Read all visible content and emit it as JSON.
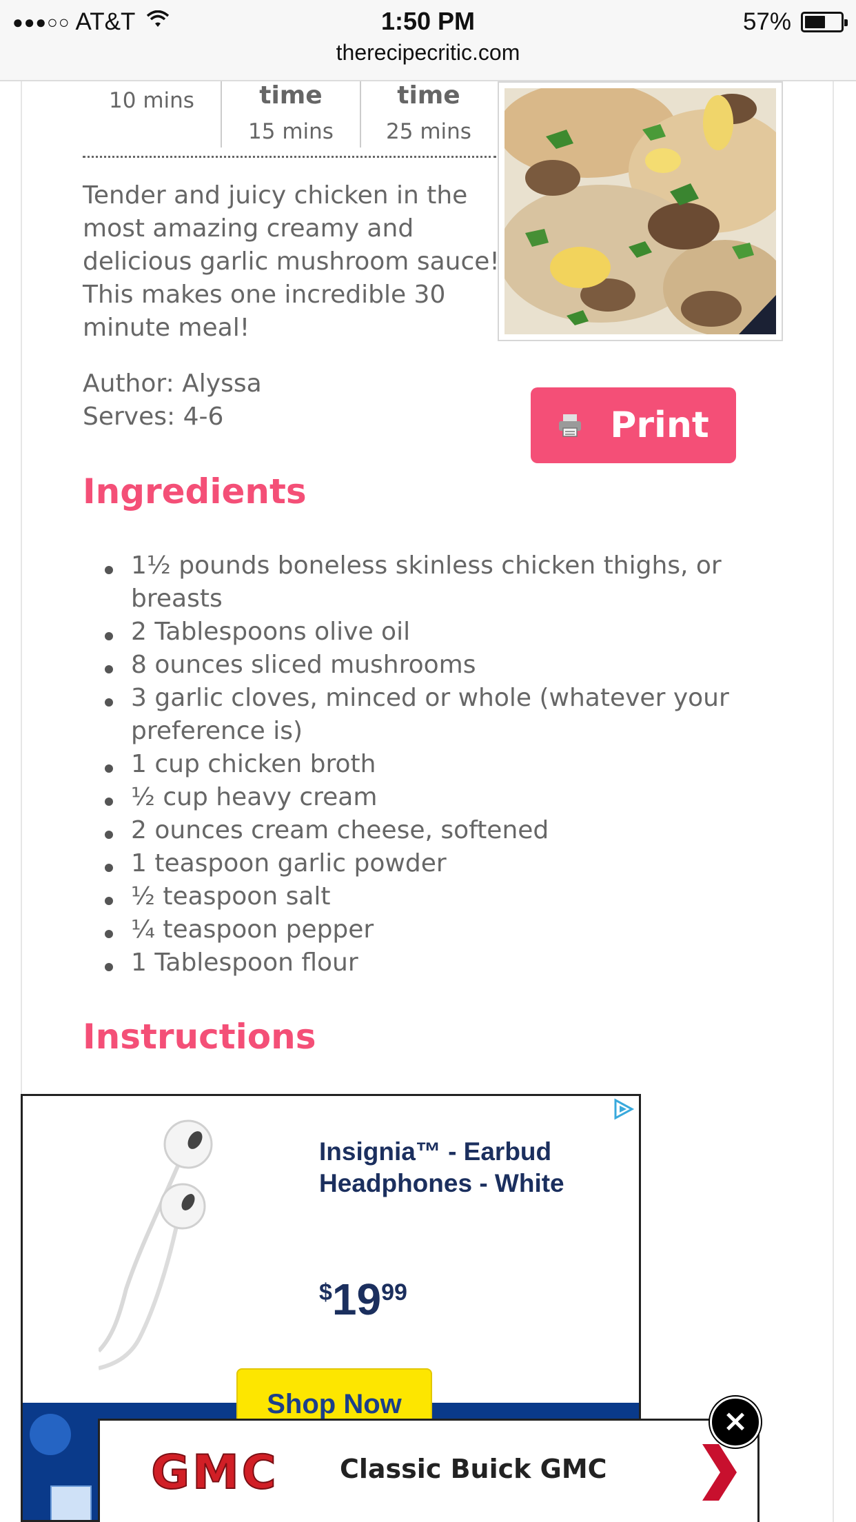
{
  "status_bar": {
    "signal": "●●●○○",
    "carrier": "AT&T",
    "time": "1:50 PM",
    "battery_percent": "57%",
    "battery_level": 0.57
  },
  "browser": {
    "url": "therecipecritic.com"
  },
  "recipe": {
    "times": [
      {
        "label": "",
        "value": "10 mins"
      },
      {
        "label": "time",
        "value": "15 mins"
      },
      {
        "label": "time",
        "value": "25 mins"
      }
    ],
    "summary": "Tender and juicy chicken in the most amazing creamy and delicious garlic mushroom sauce! This makes one incredible 30 minute meal!",
    "author": "Author: Alyssa",
    "serves": "Serves: 4-6",
    "print_label": "Print",
    "ingredients_heading": "Ingredients",
    "ingredients": [
      "1½ pounds boneless skinless chicken thighs, or breasts",
      "2 Tablespoons olive oil",
      "8 ounces sliced mushrooms",
      "3 garlic cloves, minced or whole (whatever your preference is)",
      "1 cup chicken broth",
      "½ cup heavy cream",
      "2 ounces cream cheese, softened",
      "1 teaspoon garlic powder",
      "½ teaspoon salt",
      "¼ teaspoon pepper",
      "1 Tablespoon flour"
    ],
    "instructions_heading": "Instructions"
  },
  "ad": {
    "title": "Insignia™ - Earbud Headphones - White",
    "price_currency": "$",
    "price_dollars": "19",
    "price_cents": "99",
    "cta": "Shop Now",
    "accent": "#1b2f5e",
    "cta_color": "#fde600"
  },
  "banner": {
    "logo_text": "GMC",
    "text": "Classic Buick GMC",
    "close_label": "×"
  },
  "colors": {
    "accent": "#f44f77"
  },
  "icons": [
    "wifi-icon",
    "battery-icon",
    "printer-icon",
    "adchoices-icon",
    "chevron-right-icon",
    "close-icon"
  ]
}
